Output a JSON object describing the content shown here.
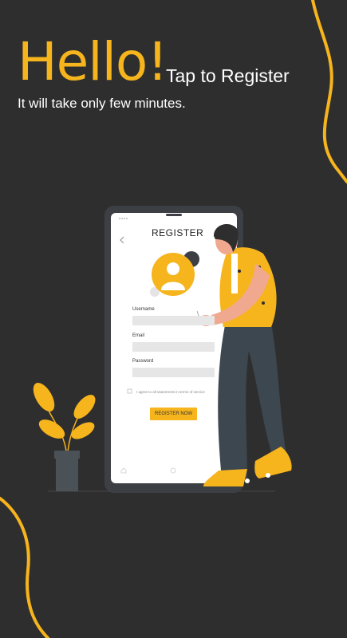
{
  "header": {
    "hello": "Hello!",
    "tap_to_register": "Tap to Register",
    "subtitle": "It will take only few minutes."
  },
  "phone_form": {
    "title": "REGISTER",
    "username_label": "Username",
    "email_label": "Email",
    "password_label": "Password",
    "agree_text": "I agree to all statements in terms of service",
    "register_button": "REGISTER NOW"
  },
  "colors": {
    "background": "#2e2e2e",
    "accent": "#f6b41d",
    "text": "#ffffff"
  },
  "icons": [
    "back-arrow-icon",
    "avatar-icon",
    "home-icon",
    "profile-icon",
    "eye-icon",
    "card-icon"
  ]
}
